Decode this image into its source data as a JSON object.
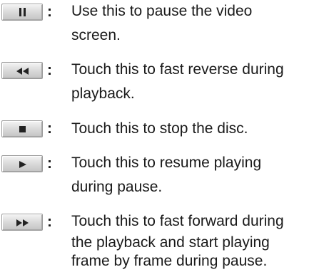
{
  "items": [
    {
      "icon": "pause-icon",
      "colon": ":",
      "lines": [
        "Use this to pause the video",
        "screen."
      ]
    },
    {
      "icon": "fast-reverse-icon",
      "colon": ":",
      "lines": [
        "Touch this to fast reverse during",
        "playback."
      ]
    },
    {
      "icon": "stop-icon",
      "colon": ":",
      "lines": [
        "Touch this to stop the disc."
      ]
    },
    {
      "icon": "play-icon",
      "colon": ":",
      "lines": [
        "Touch this to resume playing",
        "during pause."
      ]
    },
    {
      "icon": "fast-forward-icon",
      "colon": ":",
      "lines": [
        "Touch this to fast forward during",
        "the playback and start playing",
        "frame by frame during pause."
      ]
    }
  ],
  "colors": {
    "text": "#1a1a1a",
    "button_face": "#d6d6d6",
    "glyph": "#222222"
  }
}
